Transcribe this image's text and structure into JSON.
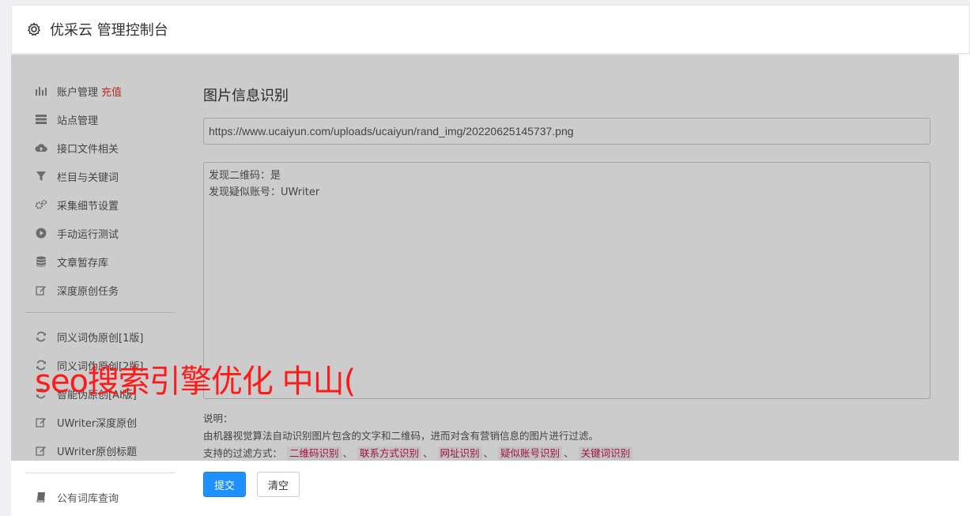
{
  "header": {
    "title": "优采云 管理控制台",
    "icon": "gear-icon"
  },
  "sidebar": {
    "groups": [
      [
        {
          "label": "账户管理",
          "badge": "充值",
          "icon": "bar-chart-icon"
        },
        {
          "label": "站点管理",
          "icon": "server-icon"
        },
        {
          "label": "接口文件相关",
          "icon": "cloud-upload-icon"
        },
        {
          "label": "栏目与关键词",
          "icon": "filter-icon"
        },
        {
          "label": "采集细节设置",
          "icon": "cogs-icon"
        },
        {
          "label": "手动运行测试",
          "icon": "play-circle-icon"
        },
        {
          "label": "文章暂存库",
          "icon": "database-icon"
        },
        {
          "label": "深度原创任务",
          "icon": "edit-icon"
        }
      ],
      [
        {
          "label": "同义词伪原创[1版]",
          "icon": "refresh-icon"
        },
        {
          "label": "同义词伪原创[2版]",
          "icon": "refresh-icon"
        },
        {
          "label": "智能伪原创[AI版]",
          "icon": "refresh-icon"
        },
        {
          "label": "UWriter深度原创",
          "icon": "edit-icon"
        },
        {
          "label": "UWriter原创标题",
          "icon": "edit-icon"
        }
      ],
      [
        {
          "label": "公有词库查询",
          "icon": "book-icon"
        }
      ]
    ]
  },
  "main": {
    "title": "图片信息识别",
    "url_value": "https://www.ucaiyun.com/uploads/ucaiyun/rand_img/20220625145737.png",
    "result_lines": [
      "发现二维码：是",
      "发现疑似账号：UWriter"
    ],
    "help": {
      "heading": "说明：",
      "desc": "由机器视觉算法自动识别图片包含的文字和二维码，进而对含有营销信息的图片进行过滤。",
      "methods_label": "支持的过滤方式：",
      "methods": [
        "二维码识别",
        "联系方式识别",
        "网址识别",
        "疑似账号识别",
        "关键词识别"
      ],
      "sep": "、"
    },
    "submit_label": "提交",
    "clear_label": "清空"
  },
  "watermark": "seo搜索引擎优化 中山("
}
